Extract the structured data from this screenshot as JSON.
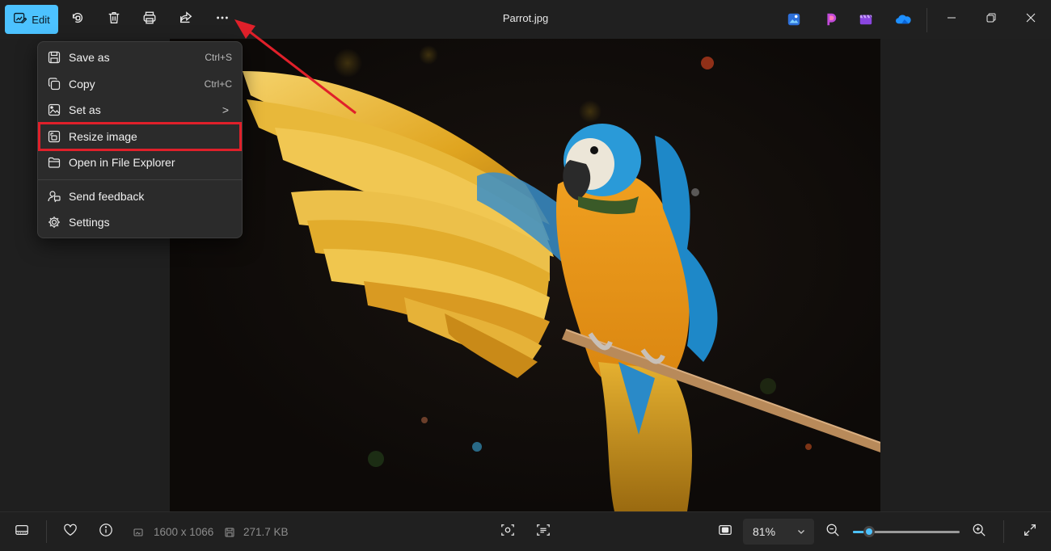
{
  "window": {
    "title": "Parrot.jpg"
  },
  "toolbar": {
    "edit_label": "Edit",
    "buttons": [
      "rotate-icon",
      "delete-icon",
      "print-icon",
      "share-icon",
      "more-options-icon"
    ],
    "app_icons": [
      "image-creator-icon",
      "clipchamp-icon",
      "video-editor-icon",
      "onedrive-icon"
    ]
  },
  "menu": {
    "items": [
      {
        "label": "Save as",
        "shortcut": "Ctrl+S",
        "icon": "save-icon"
      },
      {
        "label": "Copy",
        "shortcut": "Ctrl+C",
        "icon": "copy-icon"
      },
      {
        "label": "Set as",
        "shortcut": "",
        "submenu": true,
        "icon": "set-as-icon"
      },
      {
        "label": "Resize image",
        "shortcut": "",
        "highlighted": true,
        "icon": "resize-icon"
      },
      {
        "label": "Open in File Explorer",
        "shortcut": "",
        "icon": "folder-icon"
      },
      {
        "label": "Send feedback",
        "shortcut": "",
        "icon": "feedback-icon"
      },
      {
        "label": "Settings",
        "shortcut": "",
        "icon": "settings-icon"
      }
    ],
    "submenu_glyph": ">"
  },
  "statusbar": {
    "dimensions": "1600 x 1066",
    "file_size": "271.7 KB",
    "zoom_level": "81%",
    "zoom_slider_fraction": 0.15
  },
  "colors": {
    "accent": "#4cc2ff",
    "highlight_box": "#e0202a",
    "annotation_arrow": "#e0202a"
  }
}
